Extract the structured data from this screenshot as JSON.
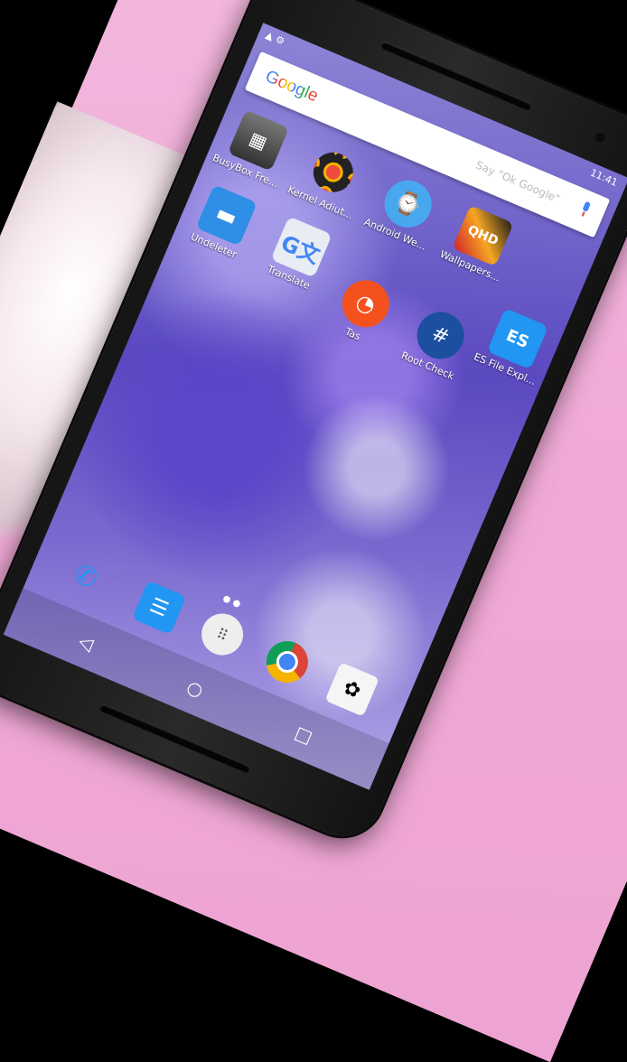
{
  "status": {
    "left_icons": "▲ ⚙",
    "time": "11:41"
  },
  "search": {
    "logo": "Google",
    "hint": "Say \"Ok Google\""
  },
  "apps": [
    {
      "name": "busybox",
      "label": "BusyBox Fre...",
      "glyph": "▦"
    },
    {
      "name": "kernel-adiutor",
      "label": "Kernel Adiut...",
      "glyph": ""
    },
    {
      "name": "android-wear",
      "label": "Android We...",
      "glyph": "⌚"
    },
    {
      "name": "wallpapers-qhd",
      "label": "Wallpapers...",
      "glyph": "QHD"
    },
    {
      "name": "undeleter",
      "label": "Undeleter",
      "glyph": "▬"
    },
    {
      "name": "translate",
      "label": "Translate",
      "glyph": "G文"
    },
    {
      "name": "tasker",
      "label": "Tas",
      "glyph": "◔"
    },
    {
      "name": "root-check",
      "label": "Root Check",
      "glyph": "#"
    },
    {
      "name": "es-file-explorer",
      "label": "ES File Expl...",
      "glyph": "ES"
    }
  ],
  "dock": {
    "phone": "✆",
    "messenger": "☰",
    "drawer": "⠿",
    "photos": "✿"
  },
  "nav": {
    "back": "◁",
    "home": "○",
    "recent": "□"
  },
  "colors": {
    "pink": "#f0a9d6",
    "accent_blue": "#2196f3"
  }
}
